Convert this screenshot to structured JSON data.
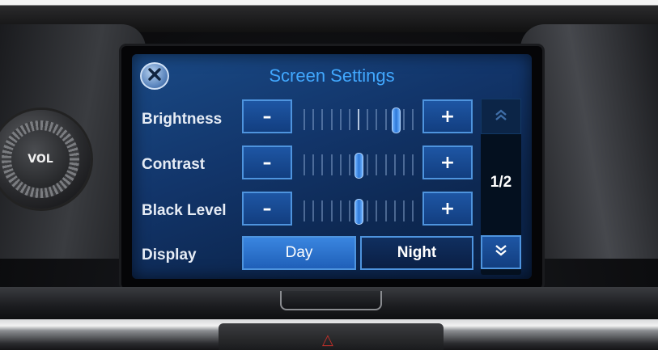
{
  "knob": {
    "label": "VOL"
  },
  "screen": {
    "title": "Screen Settings",
    "close_icon": "close-icon",
    "rows": [
      {
        "label": "Brightness",
        "minus": "–",
        "plus": "+",
        "level": 0.85
      },
      {
        "label": "Contrast",
        "minus": "–",
        "plus": "+",
        "level": 0.5
      },
      {
        "label": "Black Level",
        "minus": "–",
        "plus": "+",
        "level": 0.5
      }
    ],
    "display": {
      "label": "Display",
      "options": [
        "Day",
        "Night"
      ],
      "selected": "Day"
    },
    "pager": {
      "page": "1/2",
      "up_icon": "double-chevron-up-icon",
      "down_icon": "double-chevron-down-icon"
    }
  },
  "colors": {
    "title": "#41a8ff",
    "button_border": "#4e94de",
    "screen_bg": "#12356a"
  }
}
